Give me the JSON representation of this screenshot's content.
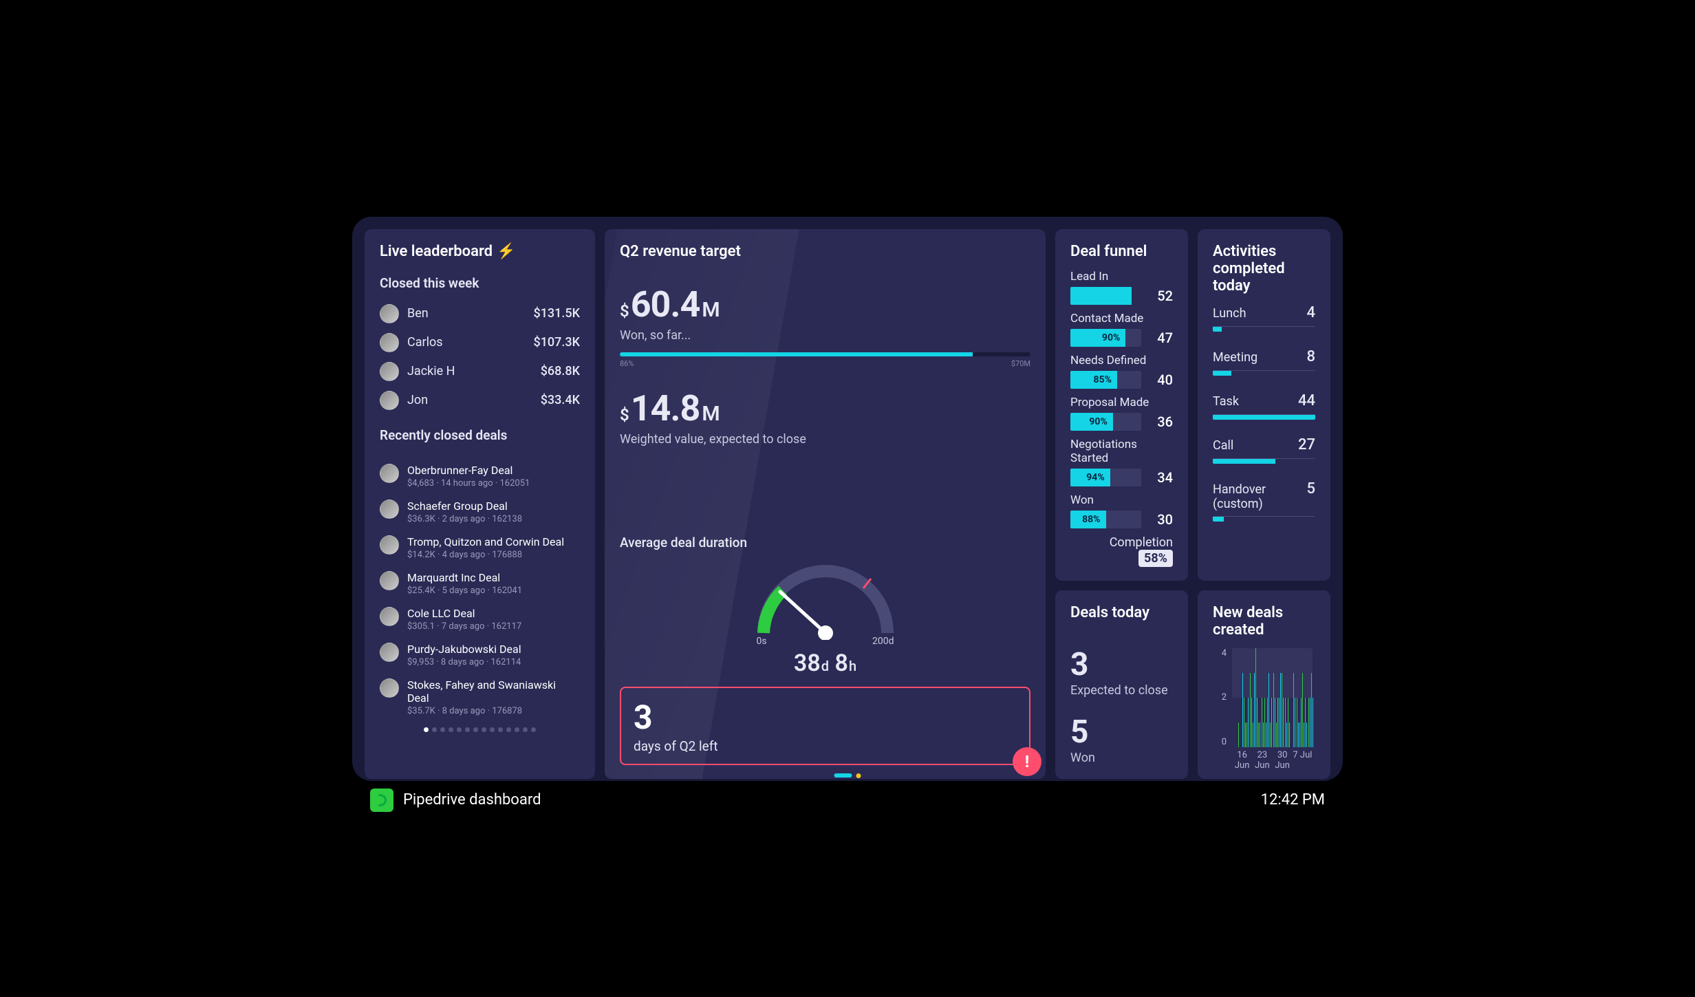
{
  "revenue": {
    "title": "Q2 revenue target",
    "won_prefix": "$",
    "won_value": "60.4",
    "won_suffix": "M",
    "won_sub": "Won, so far...",
    "progress_pct": 86,
    "progress_label_left": "86%",
    "progress_label_right": "$70M",
    "weighted_prefix": "$",
    "weighted_value": "14.8",
    "weighted_suffix": "M",
    "weighted_sub": "Weighted value, expected to close",
    "gauge_title": "Average deal duration",
    "gauge_min": "0s",
    "gauge_max": "200d",
    "gauge_value_d": "38",
    "gauge_unit_d": "d",
    "gauge_value_h": "8",
    "gauge_unit_h": "h",
    "alert_value": "3",
    "alert_text": "days of Q2 left",
    "alert_badge": "!"
  },
  "funnel": {
    "title": "Deal funnel",
    "completion_label": "Completion",
    "completion_value": "58%",
    "stages": [
      {
        "label": "Lead In",
        "count": 52,
        "width_pct": 86,
        "conv": null
      },
      {
        "label": "Contact Made",
        "count": 47,
        "width_pct": 78,
        "conv": "90%"
      },
      {
        "label": "Needs Defined",
        "count": 40,
        "width_pct": 66,
        "conv": "85%"
      },
      {
        "label": "Proposal Made",
        "count": 36,
        "width_pct": 60,
        "conv": "90%"
      },
      {
        "label": "Negotiations Started",
        "count": 34,
        "width_pct": 56,
        "conv": "94%"
      },
      {
        "label": "Won",
        "count": 30,
        "width_pct": 50,
        "conv": "88%"
      }
    ]
  },
  "activities": {
    "title": "Activities completed today",
    "max": 44,
    "items": [
      {
        "label": "Lunch",
        "count": 4
      },
      {
        "label": "Meeting",
        "count": 8
      },
      {
        "label": "Task",
        "count": 44
      },
      {
        "label": "Call",
        "count": 27
      },
      {
        "label": "Handover (custom)",
        "count": 5
      }
    ]
  },
  "deals_today": {
    "title": "Deals today",
    "expected_value": "3",
    "expected_label": "Expected to close",
    "won_value": "5",
    "won_label": "Won"
  },
  "new_deals": {
    "title": "New deals created"
  },
  "chart_data": {
    "type": "bar",
    "title": "New deals created",
    "ylim": [
      0,
      4
    ],
    "yticks": [
      0,
      2,
      4
    ],
    "xlabel": "",
    "ylabel": "",
    "x_tick_labels": [
      "16 Jun",
      "23 Jun",
      "30 Jun",
      "7 Jul"
    ],
    "band": [
      2,
      4
    ],
    "series": [
      {
        "name": "won",
        "color": "#2ecc40",
        "values": [
          0,
          0,
          1,
          0,
          2,
          1,
          3,
          1,
          4,
          1,
          2,
          2,
          2,
          1,
          3,
          1,
          2,
          3,
          2,
          2,
          0,
          3,
          2,
          1,
          3,
          2,
          2,
          3
        ]
      },
      {
        "name": "other",
        "color": "#14d4e6",
        "values": [
          0,
          0,
          0,
          3,
          1,
          2,
          2,
          3,
          2,
          1,
          1,
          1,
          3,
          2,
          2,
          2,
          3,
          2,
          1,
          1,
          0,
          2,
          1,
          2,
          1,
          1,
          2,
          2
        ]
      }
    ]
  },
  "leaderboard": {
    "title": "Live leaderboard",
    "closed_sub": "Closed this week",
    "rows": [
      {
        "name": "Ben",
        "value": "$131.5K"
      },
      {
        "name": "Carlos",
        "value": "$107.3K"
      },
      {
        "name": "Jackie H",
        "value": "$68.8K"
      },
      {
        "name": "Jon",
        "value": "$33.4K"
      }
    ],
    "deals_sub": "Recently closed deals",
    "deals": [
      {
        "title": "Oberbrunner-Fay Deal",
        "meta": "$4,683 · 14 hours ago · 162051"
      },
      {
        "title": "Schaefer Group Deal",
        "meta": "$36.3K · 2 days ago · 162138"
      },
      {
        "title": "Tromp, Quitzon and Corwin Deal",
        "meta": "$14.2K · 4 days ago · 176888"
      },
      {
        "title": "Marquardt Inc Deal",
        "meta": "$25.4K · 5 days ago · 162041"
      },
      {
        "title": "Cole LLC Deal",
        "meta": "$305.1 · 7 days ago · 162117"
      },
      {
        "title": "Purdy-Jakubowski Deal",
        "meta": "$9,953 · 8 days ago · 162114"
      },
      {
        "title": "Stokes, Fahey and Swaniawski Deal",
        "meta": "$35.7K · 8 days ago · 176878"
      }
    ],
    "dots_total": 14,
    "dots_active": 0
  },
  "footer": {
    "title": "Pipedrive dashboard",
    "time": "12:42 PM"
  }
}
